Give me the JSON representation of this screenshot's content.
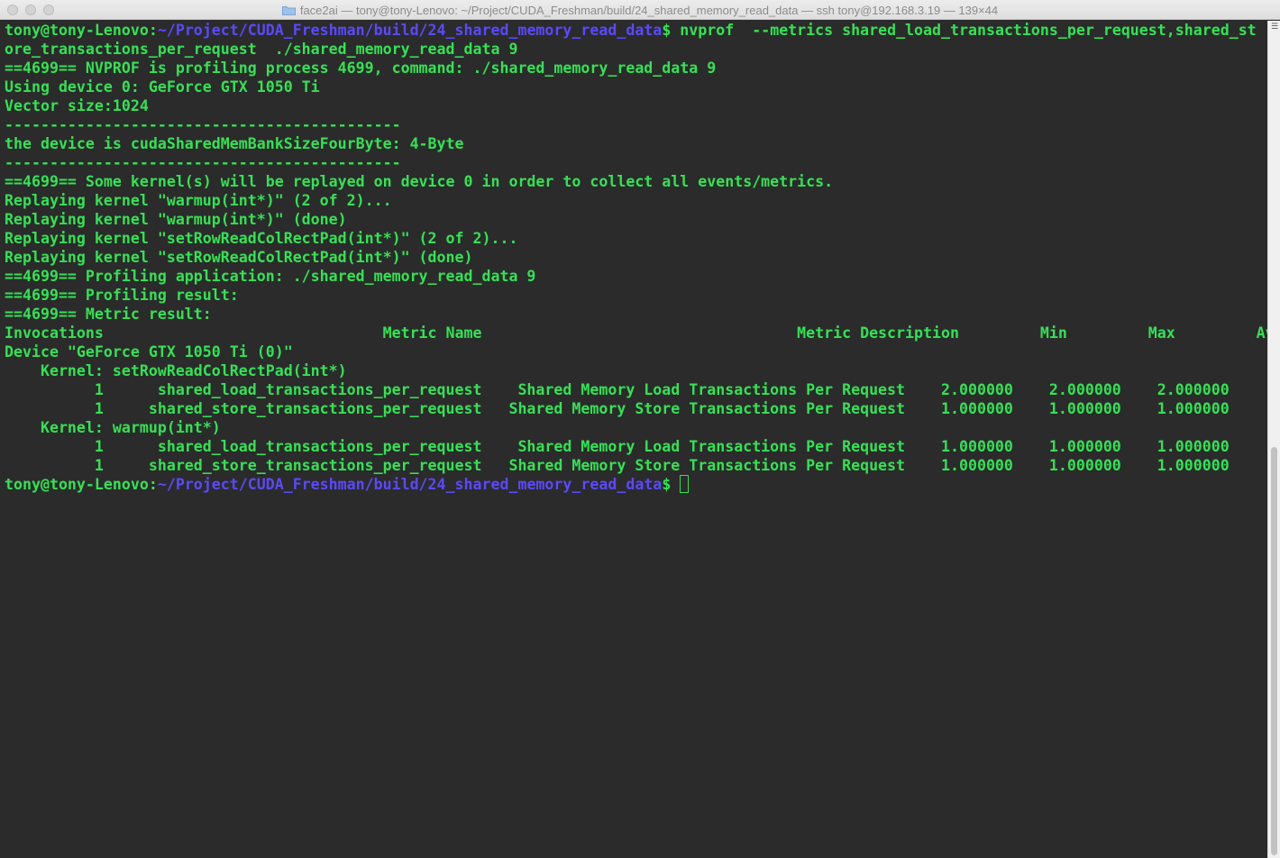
{
  "window": {
    "title": "face2ai — tony@tony-Lenovo: ~/Project/CUDA_Freshman/build/24_shared_memory_read_data — ssh tony@192.168.3.19 — 139×44"
  },
  "colors": {
    "background": "#2b2b2b",
    "text": "#34e254",
    "prompt_path": "#5a49ff"
  },
  "terminal": {
    "prompt_user": "tony@tony-Lenovo:",
    "prompt_path": "~/Project/CUDA_Freshman/build/24_shared_memory_read_data",
    "prompt_symbol": "$ ",
    "command_line1": "nvprof  --metrics shared_load_transactions_per_request,shared_st",
    "lines": [
      "ore_transactions_per_request  ./shared_memory_read_data 9",
      "==4699== NVPROF is profiling process 4699, command: ./shared_memory_read_data 9",
      "Using device 0: GeForce GTX 1050 Ti",
      "Vector size:1024",
      "--------------------------------------------",
      "the device is cudaSharedMemBankSizeFourByte: 4-Byte",
      "--------------------------------------------",
      "==4699== Some kernel(s) will be replayed on device 0 in order to collect all events/metrics.",
      "Replaying kernel \"warmup(int*)\" (2 of 2)...",
      "Replaying kernel \"warmup(int*)\" (done)",
      "Replaying kernel \"setRowReadColRectPad(int*)\" (2 of 2)...",
      "Replaying kernel \"setRowReadColRectPad(int*)\" (done)",
      "==4699== Profiling application: ./shared_memory_read_data 9",
      "==4699== Profiling result:",
      "==4699== Metric result:",
      "Invocations                               Metric Name                                   Metric Description         Min         Max         Avg",
      "Device \"GeForce GTX 1050 Ti (0)\"",
      "    Kernel: setRowReadColRectPad(int*)",
      "          1      shared_load_transactions_per_request    Shared Memory Load Transactions Per Request    2.000000    2.000000    2.000000",
      "          1     shared_store_transactions_per_request   Shared Memory Store Transactions Per Request    1.000000    1.000000    1.000000",
      "    Kernel: warmup(int*)",
      "          1      shared_load_transactions_per_request    Shared Memory Load Transactions Per Request    1.000000    1.000000    1.000000",
      "          1     shared_store_transactions_per_request   Shared Memory Store Transactions Per Request    1.000000    1.000000    1.000000"
    ]
  }
}
